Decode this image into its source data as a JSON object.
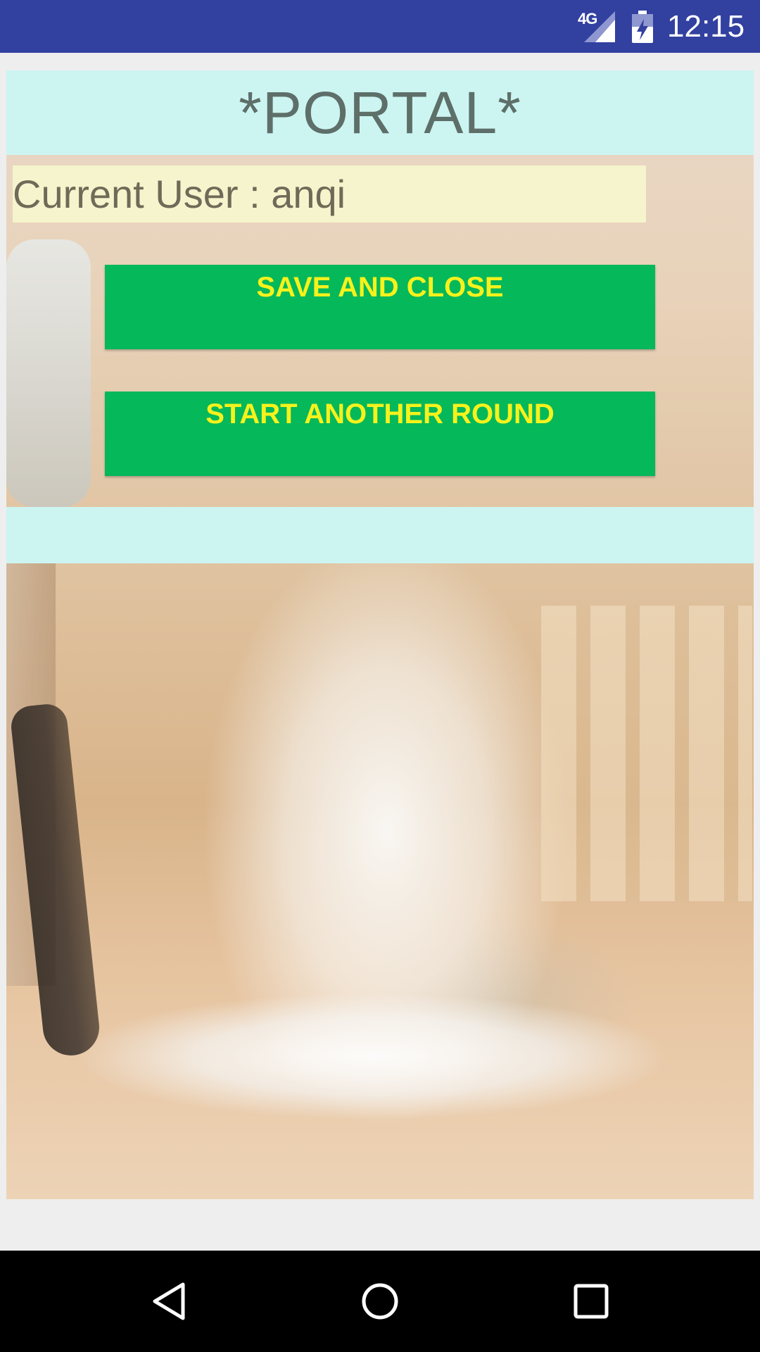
{
  "status_bar": {
    "network": "4G",
    "time": "12:15",
    "icons": [
      "signal-icon",
      "battery-charging-icon"
    ]
  },
  "portal": {
    "title": "*PORTAL*",
    "current_user_text": "Current User : anqi"
  },
  "buttons": {
    "save_and_close": "SAVE AND CLOSE",
    "start_another_round": "START ANOTHER ROUND"
  },
  "nav_bar": {
    "icons": [
      "back-icon",
      "home-icon",
      "recents-icon"
    ]
  },
  "colors": {
    "status_bar": "#3240a0",
    "title_band": "#ccf5f2",
    "button_bg": "#05b85a",
    "button_text": "#f6f21c",
    "user_bg": "#f6f6cc"
  }
}
